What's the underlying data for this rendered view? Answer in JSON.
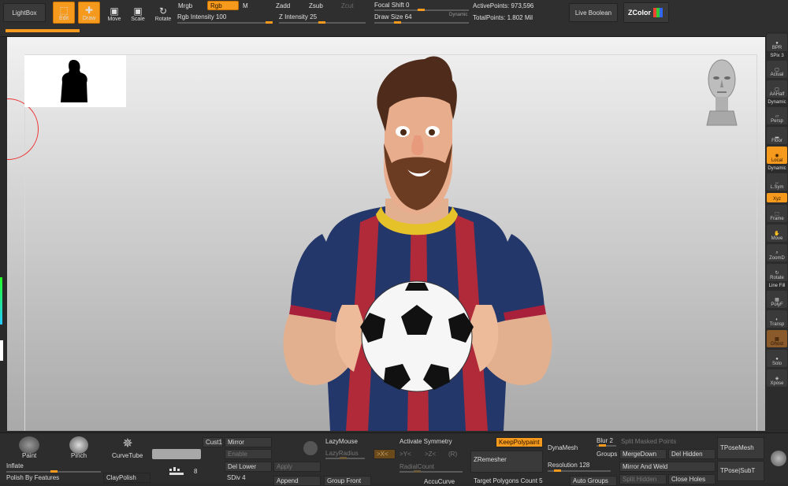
{
  "top": {
    "lightbox": "LightBox",
    "tools": [
      {
        "label": "Edit",
        "icon": "edit-icon",
        "active": true
      },
      {
        "label": "Draw",
        "icon": "draw-icon",
        "active": true
      },
      {
        "label": "Move",
        "icon": "move-icon",
        "active": false
      },
      {
        "label": "Scale",
        "icon": "scale-icon",
        "active": false
      },
      {
        "label": "Rotate",
        "icon": "rotate-icon",
        "active": false
      }
    ],
    "mrgb": "Mrgb",
    "rgb": "Rgb",
    "m": "M",
    "zadd": "Zadd",
    "zsub": "Zsub",
    "zcut": "Zcut",
    "rgb_intensity": "Rgb Intensity 100",
    "z_intensity": "Z Intensity 25",
    "focal_shift": "Focal Shift 0",
    "draw_size": "Draw Size 64",
    "dynamic": "Dynamic",
    "active_points": "ActivePoints: 973,596",
    "total_points": "TotalPoints: 1.802 Mil",
    "live_boolean": "Live Boolean",
    "zcolor": "ZColor"
  },
  "right": {
    "bpr": "BPR",
    "spix": "SPix 3",
    "tools": [
      "Actual",
      "AAHalf",
      "Persp",
      "Floor",
      "Local",
      "L.Sym",
      "Xyz",
      "Frame",
      "Move",
      "ZoomD",
      "Rotate",
      "PolyF",
      "Transp",
      "Ghost",
      "Solo",
      "Xpose"
    ],
    "dynamic": "Dynamic",
    "dynamic2": "Dynamic",
    "line_fill": "Line Fill"
  },
  "bottom": {
    "brushes": [
      "Paint",
      "Pinch",
      "CurveTube"
    ],
    "inflate": "Inflate",
    "polish": "Polish By Features",
    "claypolish": "ClayPolish",
    "stroke_num": "8",
    "cust1": "Cust1",
    "mirror": "Mirror",
    "enable": "Enable",
    "del_lower": "Del Lower",
    "apply": "Apply",
    "sdiv": "SDiv 4",
    "append": "Append",
    "lazymouse": "LazyMouse",
    "lazyradius": "LazyRadius",
    "groupfront": "Group Front",
    "activate_sym": "Activate Symmetry",
    "x": ">X<",
    "y": ">Y<",
    "z": ">Z<",
    "r": "(R)",
    "radialcount": "RadialCount",
    "accucurve": "AccuCurve",
    "keeppolypaint": "KeepPolypaint",
    "zremesher": "ZRemesher",
    "target": "Target Polygons Count 5",
    "dynamesh": "DynaMesh",
    "resolution": "Resolution 128",
    "blur": "Blur 2",
    "groups": "Groups",
    "autogroups": "Auto Groups",
    "split_masked": "Split Masked Points",
    "mergedown": "MergeDown",
    "del_hidden": "Del Hidden",
    "mirror_weld": "Mirror And Weld",
    "split_hidden": "Split Hidden",
    "close_holes": "Close Holes",
    "tposemesh": "TPoseMesh",
    "tpose_subt": "TPose|SubT"
  }
}
